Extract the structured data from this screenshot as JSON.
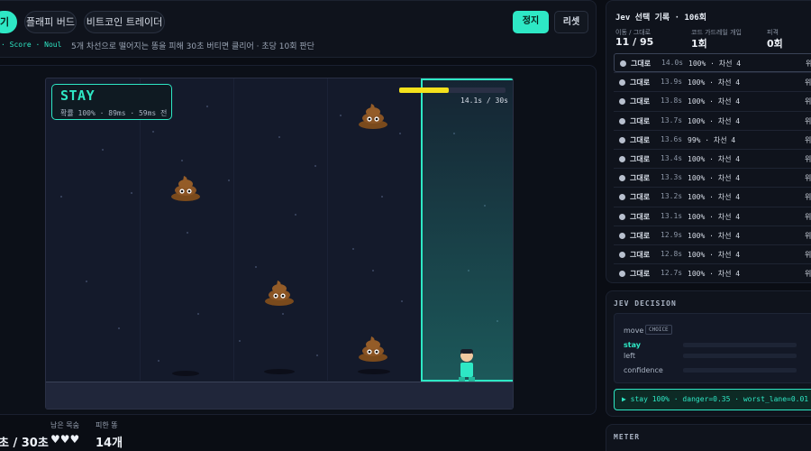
{
  "tabs": [
    {
      "label": "기"
    },
    {
      "label": "플래피 버드"
    },
    {
      "label": "비트코인 트레이더"
    }
  ],
  "breadcrumb": "· Score · Noul",
  "description": "5개 차선으로 떨어지는 똥을 피해 30초 버티면 클리어 · 초당 10회 판단",
  "controls": {
    "stop": "정지",
    "reset": "리셋"
  },
  "game": {
    "decision_title": "STAY",
    "decision_sub": "확률 100% · 89ms · 59ms 전",
    "timer_label": "14.1s / 30s",
    "timer_progress": 0.47,
    "poo_icon": "poop-emoji-icon",
    "player_icon": "runner-character-icon"
  },
  "stats": {
    "time_label": "",
    "time_value": "초 / 30초",
    "lives_label": "남은 목숨",
    "lives_value": "♥♥♥",
    "dodged_label": "피한 똥",
    "dodged_value": "14개"
  },
  "log": {
    "title": "Jev 선택 기록 · 106회",
    "kpis": [
      {
        "label": "이동 / 그대로",
        "value": "11 / 95"
      },
      {
        "label": "코드 가드레일 개입",
        "value": "1회"
      },
      {
        "label": "피격",
        "value": "0회"
      }
    ],
    "rows": [
      {
        "action": "그대로",
        "time": "14.0s",
        "prob": "100% · 차선 4",
        "risk": "위"
      },
      {
        "action": "그대로",
        "time": "13.9s",
        "prob": "100% · 차선 4",
        "risk": "위"
      },
      {
        "action": "그대로",
        "time": "13.8s",
        "prob": "100% · 차선 4",
        "risk": "위"
      },
      {
        "action": "그대로",
        "time": "13.7s",
        "prob": "100% · 차선 4",
        "risk": "위"
      },
      {
        "action": "그대로",
        "time": "13.6s",
        "prob": "99% · 차선 4",
        "risk": "위"
      },
      {
        "action": "그대로",
        "time": "13.4s",
        "prob": "100% · 차선 4",
        "risk": "위"
      },
      {
        "action": "그대로",
        "time": "13.3s",
        "prob": "100% · 차선 4",
        "risk": "위"
      },
      {
        "action": "그대로",
        "time": "13.2s",
        "prob": "100% · 차선 4",
        "risk": "위"
      },
      {
        "action": "그대로",
        "time": "13.1s",
        "prob": "100% · 차선 4",
        "risk": "위"
      },
      {
        "action": "그대로",
        "time": "12.9s",
        "prob": "100% · 차선 4",
        "risk": "위"
      },
      {
        "action": "그대로",
        "time": "12.8s",
        "prob": "100% · 차선 4",
        "risk": "위"
      },
      {
        "action": "그대로",
        "time": "12.7s",
        "prob": "100% · 차선 4",
        "risk": "위"
      }
    ]
  },
  "decision": {
    "title": "JEV DECISION",
    "move_label": "move",
    "choice_badge": "CHOICE",
    "s_glyph": "S",
    "options": [
      "stay",
      "left",
      "confidence"
    ],
    "result": "▶ stay 100% · danger=0.35 · worst_lane=0.01"
  },
  "meter": {
    "title": "METER"
  },
  "colors": {
    "accent": "#2ee8c5",
    "timer": "#f4e11c",
    "bg": "#0a0d14"
  }
}
